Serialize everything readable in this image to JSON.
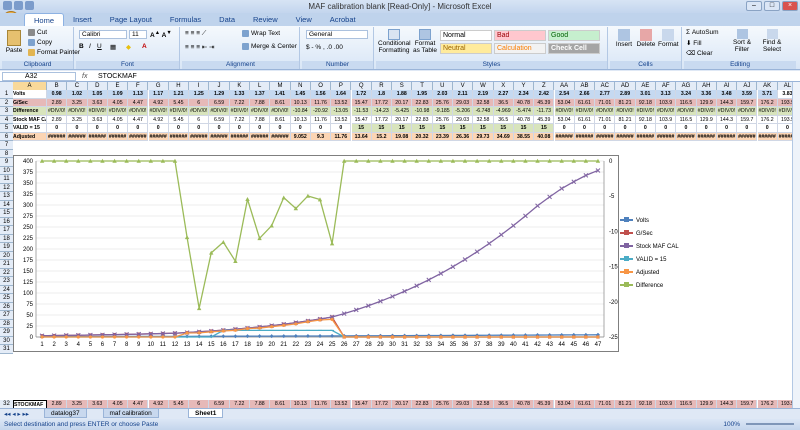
{
  "window": {
    "title": "MAF calibration blank  [Read-Only]  -  Microsoft Excel"
  },
  "ribbon": {
    "tabs": [
      "Home",
      "Insert",
      "Page Layout",
      "Formulas",
      "Data",
      "Review",
      "View",
      "Acrobat"
    ],
    "active_tab": "Home",
    "clipboard": {
      "paste": "Paste",
      "cut": "Cut",
      "copy": "Copy",
      "format_painter": "Format Painter",
      "label": "Clipboard"
    },
    "font": {
      "name": "Calibri",
      "size": "11",
      "label": "Font"
    },
    "alignment": {
      "wrap": "Wrap Text",
      "merge": "Merge & Center",
      "label": "Alignment"
    },
    "number": {
      "format": "General",
      "symbols": "$ - % , .0 .00",
      "label": "Number"
    },
    "styles": {
      "cond": "Conditional Formatting",
      "table": "Format as Table",
      "normal": "Normal",
      "bad": "Bad",
      "good": "Good",
      "neutral": "Neutral",
      "calculation": "Calculation",
      "check_cell": "Check Cell",
      "label": "Styles"
    },
    "cells": {
      "insert": "Insert",
      "delete": "Delete",
      "format": "Format",
      "label": "Cells"
    },
    "editing": {
      "autosum": "AutoSum",
      "fill": "Fill",
      "clear": "Clear",
      "sort": "Sort & Filter",
      "find": "Find & Select",
      "label": "Editing"
    }
  },
  "formula_bar": {
    "name_box": "A32",
    "fx": "fx",
    "content": "STOCKMAF"
  },
  "columns": [
    "A",
    "B",
    "C",
    "D",
    "E",
    "F",
    "G",
    "H",
    "I",
    "J",
    "K",
    "L",
    "M",
    "N",
    "O",
    "P",
    "Q",
    "R",
    "S",
    "T",
    "U",
    "V",
    "W",
    "X",
    "Y",
    "Z",
    "AA",
    "AB",
    "AC",
    "AD",
    "AE",
    "AF",
    "AG",
    "AH",
    "AI",
    "AJ",
    "AK",
    "AL"
  ],
  "rows": {
    "r1": {
      "label": "Volts",
      "values": [
        "0.98",
        "1.02",
        "1.05",
        "1.09",
        "1.13",
        "1.17",
        "1.21",
        "1.25",
        "1.29",
        "1.33",
        "1.37",
        "1.41",
        "1.45",
        "1.56",
        "1.64",
        "1.72",
        "1.8",
        "1.88",
        "1.95",
        "2.03",
        "2.11",
        "2.19",
        "2.27",
        "2.34",
        "2.42",
        "2.54",
        "2.66",
        "2.77",
        "2.89",
        "3.01",
        "3.13",
        "3.24",
        "3.36",
        "3.48",
        "3.59",
        "3.71",
        "3.83"
      ]
    },
    "r2": {
      "label": "G/Sec",
      "values": [
        "2.89",
        "3.25",
        "3.63",
        "4.05",
        "4.47",
        "4.92",
        "5.45",
        "6",
        "6.59",
        "7.22",
        "7.88",
        "8.61",
        "10.13",
        "11.76",
        "13.52",
        "15.47",
        "17.72",
        "20.17",
        "22.83",
        "25.76",
        "29.03",
        "32.58",
        "36.5",
        "40.78",
        "45.39",
        "53.04",
        "61.61",
        "71.01",
        "81.21",
        "92.18",
        "103.9",
        "116.5",
        "129.9",
        "144.3",
        "159.7",
        "176.2",
        "193.9"
      ]
    },
    "r3": {
      "label": "Difference",
      "values": [
        "#DIV/0!",
        "#DIV/0!",
        "#DIV/0!",
        "#DIV/0!",
        "#DIV/0!",
        "#DIV/0!",
        "#DIV/0!",
        "#DIV/0!",
        "#DIV/0!",
        "#DIV/0!",
        "#DIV/0!",
        "#DIV/0!",
        "-10.84",
        "-20.92",
        "-13.05",
        "-11.53",
        "-14.23",
        "-5.425",
        "-10.98",
        "-9.185",
        "-5.206",
        "-6.748",
        "-4.969",
        "-5.474",
        "-11.73",
        "#DIV/0!",
        "#DIV/0!",
        "#DIV/0!",
        "#DIV/0!",
        "#DIV/0!",
        "#DIV/0!",
        "#DIV/0!",
        "#DIV/0!",
        "#DIV/0!",
        "#DIV/0!",
        "#DIV/0!",
        "#DIV/0!"
      ]
    },
    "r4": {
      "label": "Stock MAF CAL",
      "values": [
        "2.89",
        "3.25",
        "3.63",
        "4.05",
        "4.47",
        "4.92",
        "5.45",
        "6",
        "6.59",
        "7.22",
        "7.88",
        "8.61",
        "10.13",
        "11.76",
        "13.52",
        "15.47",
        "17.72",
        "20.17",
        "22.83",
        "25.76",
        "29.03",
        "32.58",
        "36.5",
        "40.78",
        "45.39",
        "53.04",
        "61.61",
        "71.01",
        "81.21",
        "92.18",
        "103.9",
        "116.5",
        "129.9",
        "144.3",
        "159.7",
        "176.2",
        "193.9"
      ]
    },
    "r5": {
      "label": "VALID = 15",
      "values": [
        "0",
        "0",
        "0",
        "0",
        "0",
        "0",
        "0",
        "0",
        "0",
        "0",
        "0",
        "0",
        "0",
        "0",
        "0",
        "15",
        "15",
        "15",
        "15",
        "15",
        "15",
        "15",
        "15",
        "15",
        "15",
        "0",
        "0",
        "0",
        "0",
        "0",
        "0",
        "0",
        "0",
        "0",
        "0",
        "0",
        "0"
      ]
    },
    "r6": {
      "label": "Adjusted",
      "values": [
        "######",
        "######",
        "######",
        "######",
        "######",
        "######",
        "######",
        "######",
        "######",
        "######",
        "######",
        "######",
        "9.052",
        "9.3",
        "11.76",
        "13.64",
        "15.2",
        "19.08",
        "20.32",
        "23.39",
        "26.36",
        "29.73",
        "34.69",
        "38.55",
        "40.08",
        "######",
        "######",
        "######",
        "######",
        "######",
        "######",
        "######",
        "######",
        "######",
        "######",
        "######",
        "######"
      ]
    },
    "r32": {
      "label": "STOCKMAF",
      "values": [
        "2.89",
        "3.25",
        "3.63",
        "4.05",
        "4.47",
        "4.92",
        "5.45",
        "6",
        "6.59",
        "7.22",
        "7.88",
        "8.61",
        "10.13",
        "11.76",
        "13.52",
        "15.47",
        "17.72",
        "20.17",
        "22.83",
        "25.76",
        "29.03",
        "32.58",
        "36.5",
        "40.78",
        "45.39",
        "53.04",
        "61.61",
        "71.01",
        "81.21",
        "92.18",
        "103.9",
        "116.5",
        "129.9",
        "144.3",
        "159.7",
        "176.2",
        "193.9"
      ]
    }
  },
  "row_numbers": [
    "1",
    "2",
    "3",
    "4",
    "5",
    "6",
    "7",
    "8",
    "9",
    "10",
    "11",
    "12",
    "13",
    "14",
    "15",
    "16",
    "17",
    "18",
    "19",
    "20",
    "21",
    "22",
    "23",
    "24",
    "25",
    "26",
    "27",
    "28",
    "29",
    "30",
    "31"
  ],
  "chart_data": {
    "type": "line",
    "x": [
      1,
      2,
      3,
      4,
      5,
      6,
      7,
      8,
      9,
      10,
      11,
      12,
      13,
      14,
      15,
      16,
      17,
      18,
      19,
      20,
      21,
      22,
      23,
      24,
      25,
      26,
      27,
      28,
      29,
      30,
      31,
      32,
      33,
      34,
      35,
      36,
      37,
      38,
      39,
      40,
      41,
      42,
      43,
      44,
      45,
      46,
      47
    ],
    "ylim": [
      0,
      400
    ],
    "y2lim": [
      -25,
      0
    ],
    "yticks": [
      0,
      25,
      50,
      75,
      100,
      125,
      150,
      175,
      200,
      225,
      250,
      275,
      300,
      325,
      350,
      375,
      400
    ],
    "y2ticks": [
      0,
      -5,
      -10,
      -15,
      -20,
      -25
    ],
    "series": [
      {
        "name": "Volts",
        "color": "#4f81bd",
        "values": [
          0.98,
          1.02,
          1.05,
          1.09,
          1.13,
          1.17,
          1.21,
          1.25,
          1.29,
          1.33,
          1.37,
          1.41,
          1.45,
          1.56,
          1.64,
          1.72,
          1.8,
          1.88,
          1.95,
          2.03,
          2.11,
          2.19,
          2.27,
          2.34,
          2.42,
          2.54,
          2.66,
          2.77,
          2.89,
          3.01,
          3.13,
          3.24,
          3.36,
          3.48,
          3.59,
          3.71,
          3.83,
          3.95,
          4.07,
          4.18,
          4.3,
          4.42,
          4.53,
          4.65,
          4.77,
          4.88,
          5.0
        ]
      },
      {
        "name": "G/Sec",
        "color": "#c0504d",
        "values": [
          2.89,
          3.25,
          3.63,
          4.05,
          4.47,
          4.92,
          5.45,
          6,
          6.59,
          7.22,
          7.88,
          8.61,
          10.13,
          11.76,
          13.52,
          15.47,
          17.72,
          20.17,
          22.83,
          25.76,
          29.03,
          32.58,
          36.5,
          40.78,
          45.39,
          0,
          0,
          0,
          0,
          0,
          0,
          0,
          0,
          0,
          0,
          0,
          0,
          0,
          0,
          0,
          0,
          0,
          0,
          0,
          0,
          0,
          0
        ]
      },
      {
        "name": "Stock MAF CAL",
        "color": "#8064a2",
        "values": [
          2.89,
          3.25,
          3.63,
          4.05,
          4.47,
          4.92,
          5.45,
          6,
          6.59,
          7.22,
          7.88,
          8.61,
          10.13,
          11.76,
          13.52,
          15.47,
          17.72,
          20.17,
          22.83,
          25.76,
          29.03,
          32.58,
          36.5,
          40.78,
          45.39,
          53.04,
          61.61,
          71.01,
          81.21,
          92.18,
          103.9,
          116.5,
          129.9,
          144.3,
          159.7,
          176.2,
          193.9,
          212.5,
          232.3,
          253.1,
          275.2,
          298.3,
          318.5,
          337.5,
          352.9,
          367.3,
          378.5
        ]
      },
      {
        "name": "VALID = 15",
        "color": "#4bacc6",
        "values": [
          0,
          0,
          0,
          0,
          0,
          0,
          0,
          0,
          0,
          0,
          0,
          0,
          0,
          0,
          0,
          15,
          15,
          15,
          15,
          15,
          15,
          15,
          15,
          15,
          15,
          0,
          0,
          0,
          0,
          0,
          0,
          0,
          0,
          0,
          0,
          0,
          0,
          0,
          0,
          0,
          0,
          0,
          0,
          0,
          0,
          0,
          0
        ]
      },
      {
        "name": "Adjusted",
        "color": "#f79646",
        "values": [
          0,
          0,
          0,
          0,
          0,
          0,
          0,
          0,
          0,
          0,
          0,
          0,
          9.05,
          9.3,
          11.76,
          13.64,
          15.2,
          19.08,
          20.32,
          23.39,
          26.36,
          29.73,
          34.69,
          38.55,
          40.08,
          0,
          0,
          0,
          0,
          0,
          0,
          0,
          0,
          0,
          0,
          0,
          0,
          0,
          0,
          0,
          0,
          0,
          0,
          0,
          0,
          0,
          0
        ]
      },
      {
        "name": "Difference",
        "color": "#9bbb59",
        "axis": "secondary",
        "values": [
          0,
          0,
          0,
          0,
          0,
          0,
          0,
          0,
          0,
          0,
          0,
          0,
          -10.84,
          -20.92,
          -13.05,
          -11.53,
          -14.23,
          -5.425,
          -10.98,
          -9.185,
          -5.206,
          -6.748,
          -4.969,
          -5.474,
          -11.73,
          0,
          0,
          0,
          0,
          0,
          0,
          0,
          0,
          0,
          0,
          0,
          0,
          0,
          0,
          0,
          0,
          0,
          0,
          0,
          0,
          0,
          0
        ]
      }
    ]
  },
  "sheet_tabs": [
    "datalog37",
    "maf calibration",
    "Sheet1"
  ],
  "active_sheet": "Sheet1",
  "status": {
    "text": "Select destination and press ENTER or choose Paste",
    "zoom": "100%"
  }
}
